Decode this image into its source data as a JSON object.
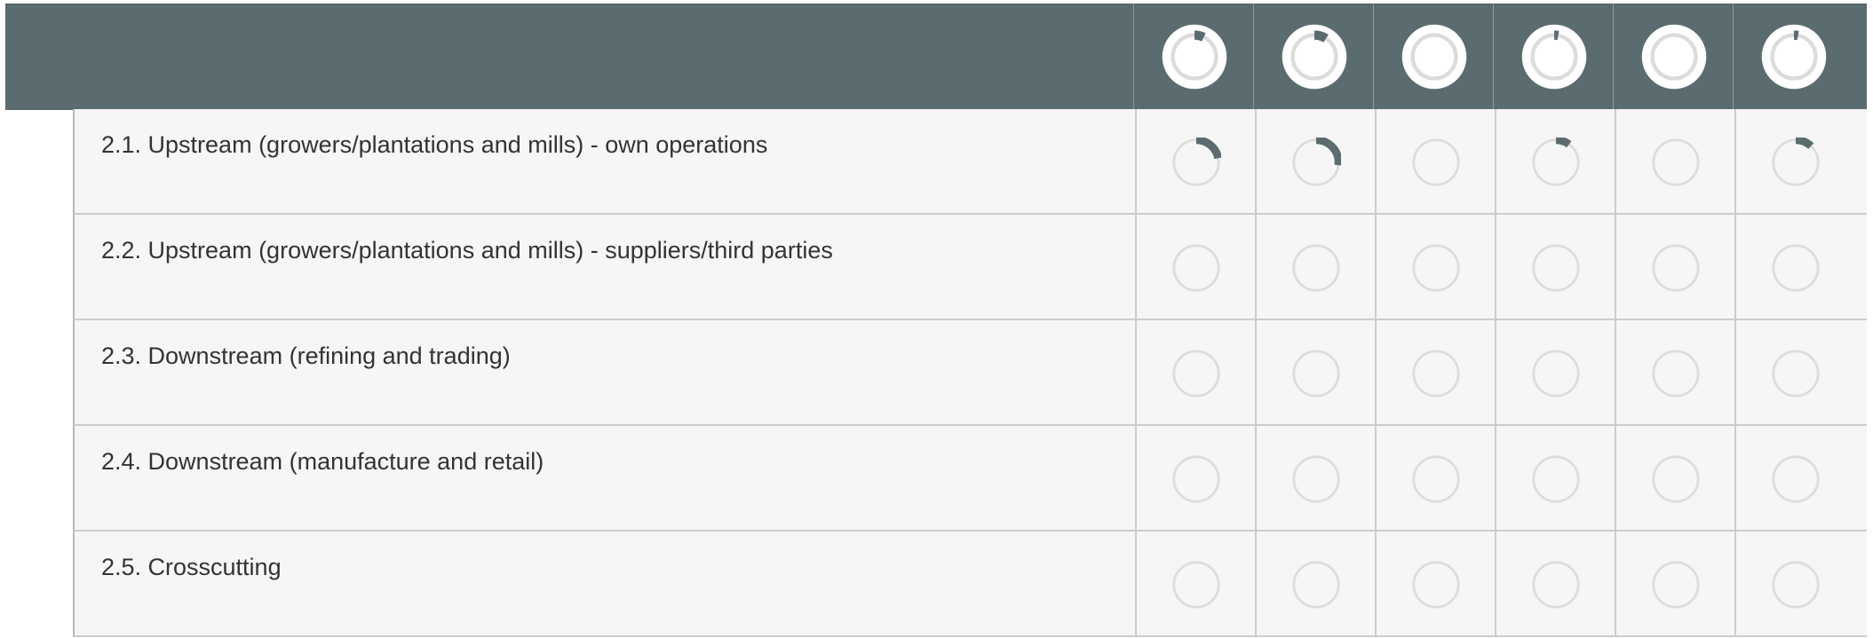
{
  "colors": {
    "header_bg": "#5b6c70",
    "row_bg": "#f6f6f6",
    "ring": "#dcdcdc",
    "indicator": "#5b6c70",
    "text": "#333333"
  },
  "header": {
    "column_count": 6,
    "columns": [
      {
        "icon": "progress-ring-icon",
        "level": 0.07
      },
      {
        "icon": "progress-ring-icon",
        "level": 0.09
      },
      {
        "icon": "progress-ring-icon",
        "level": 0
      },
      {
        "icon": "progress-ring-icon",
        "level": 0.03
      },
      {
        "icon": "progress-ring-icon",
        "level": 0
      },
      {
        "icon": "progress-ring-icon",
        "level": 0.03
      }
    ]
  },
  "rows": [
    {
      "label": "2.1. Upstream (growers/plantations and mills) - own operations",
      "levels": [
        0.22,
        0.27,
        0,
        0.1,
        0,
        0.12
      ]
    },
    {
      "label": "2.2. Upstream (growers/plantations and mills) - suppliers/third parties",
      "levels": [
        0,
        0,
        0,
        0,
        0,
        0
      ]
    },
    {
      "label": "2.3. Downstream (refining and trading)",
      "levels": [
        0,
        0,
        0,
        0,
        0,
        0
      ]
    },
    {
      "label": "2.4. Downstream (manufacture and retail)",
      "levels": [
        0,
        0,
        0,
        0,
        0,
        0
      ]
    },
    {
      "label": "2.5. Crosscutting",
      "levels": [
        0,
        0,
        0,
        0,
        0,
        0
      ]
    }
  ]
}
